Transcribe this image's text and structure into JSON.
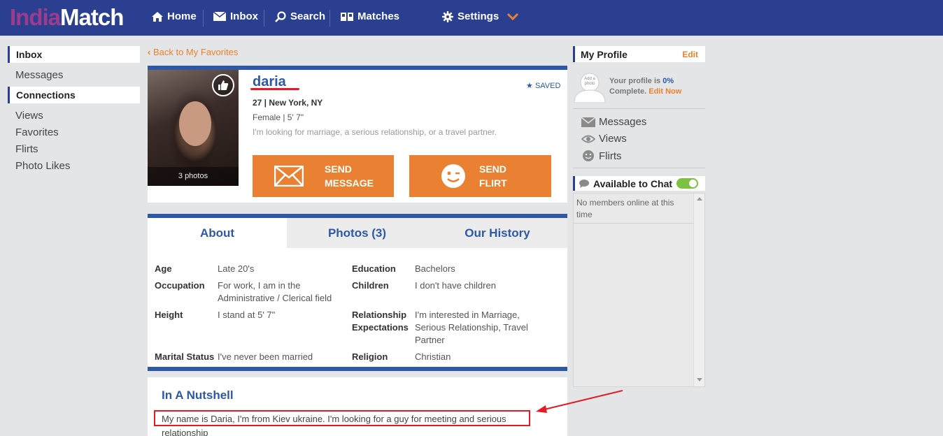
{
  "brand": {
    "india": "India",
    "match": "Match"
  },
  "nav": {
    "home": "Home",
    "inbox": "Inbox",
    "search": "Search",
    "matches": "Matches",
    "settings": "Settings"
  },
  "left": {
    "inbox_header": "Inbox",
    "messages": "Messages",
    "connections_header": "Connections",
    "views": "Views",
    "favorites": "Favorites",
    "flirts": "Flirts",
    "photo_likes": "Photo Likes"
  },
  "back_link": "Back to My Favorites",
  "profile": {
    "name": "daria",
    "saved": "SAVED",
    "age_location": "27 | New York, NY",
    "gender_height": "Female | 5' 7\"",
    "looking_for": "I'm looking for marriage, a serious relationship, or a travel partner.",
    "photo_count": "3 photos",
    "send_message_1": "SEND",
    "send_message_2": "MESSAGE",
    "send_flirt_1": "SEND",
    "send_flirt_2": "FLIRT"
  },
  "tabs": {
    "about": "About",
    "photos": "Photos (3)",
    "history": "Our History"
  },
  "details": {
    "age_label": "Age",
    "age_value": "Late 20's",
    "occupation_label": "Occupation",
    "occupation_value_1": "For work, I am in the",
    "occupation_value_2": "Administrative / Clerical field",
    "height_label": "Height",
    "height_value": "I stand at 5' 7\"",
    "marital_label": "Marital Status",
    "marital_value": "I've never been married",
    "education_label": "Education",
    "education_value": "Bachelors",
    "children_label": "Children",
    "children_value": "I don't have children",
    "relationship_label_1": "Relationship",
    "relationship_label_2": "Expectations",
    "relationship_value_1": "I'm interested in Marriage,",
    "relationship_value_2": "Serious Relationship, Travel",
    "relationship_value_3": "Partner",
    "religion_label": "Religion",
    "religion_value": "Christian"
  },
  "nutshell": {
    "title": "In A Nutshell",
    "line1": "My name is Daria, I'm from Kiev ukraine. I'm looking for a guy for meeting and serious",
    "line2": "relationship"
  },
  "right": {
    "my_profile": "My Profile",
    "edit": "Edit",
    "avatar_text": "Add a photo",
    "complete_1": "Your profile is ",
    "complete_pct": "0%",
    "complete_2": "Complete. ",
    "edit_now": "Edit Now",
    "messages": "Messages",
    "views": "Views",
    "flirts": "Flirts",
    "chat_header": "Available to Chat",
    "no_members": "No members online at this time"
  },
  "colors": {
    "header": "#2a3f8f",
    "accent_blue": "#2d58a6",
    "orange": "#ea8132",
    "annotation_red": "#e31b23"
  }
}
